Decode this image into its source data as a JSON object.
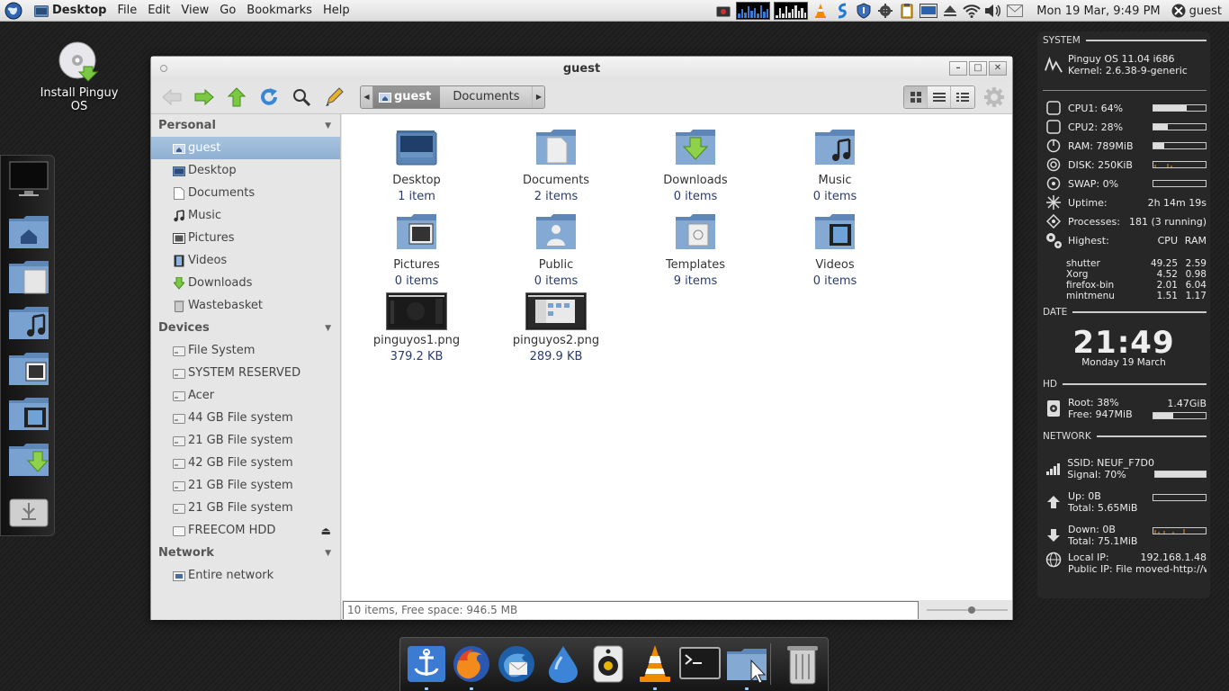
{
  "top_panel": {
    "places_label": "Desktop",
    "menus": [
      "File",
      "Edit",
      "View",
      "Go",
      "Bookmarks",
      "Help"
    ],
    "clock": "Mon 19 Mar,  9:49 PM",
    "user": "guest"
  },
  "desktop": {
    "install_label": "Install Pinguy OS"
  },
  "window": {
    "title": "guest",
    "path": [
      "guest",
      "Documents"
    ],
    "status": "10 items, Free space: 946.5 MB"
  },
  "sidebar": {
    "personal_header": "Personal",
    "personal": [
      "guest",
      "Desktop",
      "Documents",
      "Music",
      "Pictures",
      "Videos",
      "Downloads",
      "Wastebasket"
    ],
    "devices_header": "Devices",
    "devices": [
      "File System",
      "SYSTEM RESERVED",
      "Acer",
      "44 GB File system",
      "21 GB File system",
      "42 GB File system",
      "21 GB File system",
      "21 GB File system",
      "FREECOM HDD"
    ],
    "network_header": "Network",
    "network": [
      "Entire network"
    ]
  },
  "files": [
    {
      "name": "Desktop",
      "info": "1 item"
    },
    {
      "name": "Documents",
      "info": "2 items"
    },
    {
      "name": "Downloads",
      "info": "0 items"
    },
    {
      "name": "Music",
      "info": "0 items"
    },
    {
      "name": "Pictures",
      "info": "0 items"
    },
    {
      "name": "Public",
      "info": "0 items"
    },
    {
      "name": "Templates",
      "info": "9 items"
    },
    {
      "name": "Videos",
      "info": "0 items"
    },
    {
      "name": "pinguyos1.png",
      "info": "379.2 KB"
    },
    {
      "name": "pinguyos2.png",
      "info": "289.9 KB"
    }
  ],
  "conky": {
    "system_header": "SYSTEM",
    "os": "Pinguy OS 11.04 i686",
    "kernel": "Kernel: 2.6.38-9-generic",
    "cpu1": "CPU1: 64%",
    "cpu1_level": 0.64,
    "cpu2": "CPU2: 28%",
    "cpu2_level": 0.28,
    "ram": "RAM: 789MiB",
    "ram_level": 0.2,
    "disk": "DISK: 250KiB",
    "swap": "SWAP: 0%",
    "uptime_label": "Uptime:",
    "uptime": "2h 14m 19s",
    "processes_label": "Processes:",
    "processes": "181 (3 running)",
    "highest_label": "Highest:",
    "cpu_col": "CPU",
    "ram_col": "RAM",
    "procs": [
      {
        "name": "shutter",
        "cpu": "49.25",
        "ram": "2.59"
      },
      {
        "name": "Xorg",
        "cpu": "4.52",
        "ram": "0.98"
      },
      {
        "name": "firefox-bin",
        "cpu": "2.01",
        "ram": "6.04"
      },
      {
        "name": "mintmenu",
        "cpu": "1.51",
        "ram": "1.17"
      }
    ],
    "date_header": "DATE",
    "time": "21:49",
    "date": "Monday 19 March",
    "hd_header": "HD",
    "root": "Root: 38%",
    "root_size": "1.47GiB",
    "free": "Free: 947MiB",
    "root_level": 0.38,
    "network_header": "NETWORK",
    "ssid": "SSID: NEUF_F7D0",
    "signal": "Signal: 70%",
    "signal_level": 1.0,
    "up": "Up: 0B",
    "up_total": "Total: 5.65MiB",
    "down": "Down: 0B",
    "down_total": "Total: 75.1MiB",
    "local_ip_label": "Local IP:",
    "local_ip": "192.168.1.48",
    "public_ip": "Public IP: File moved-http://ww"
  }
}
